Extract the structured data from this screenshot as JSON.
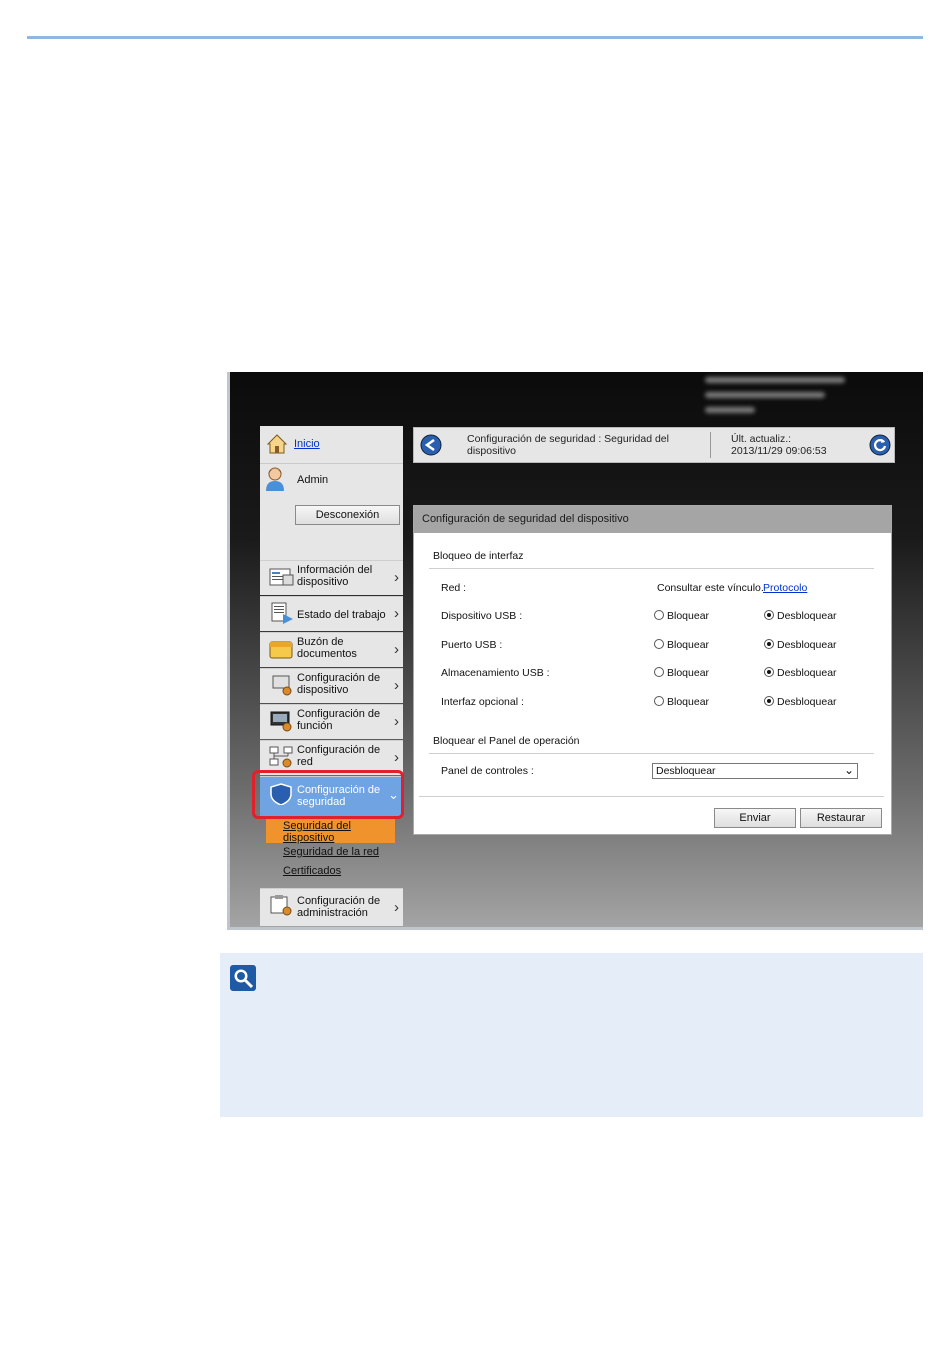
{
  "sidebar": {
    "home_label": "Inicio",
    "user_label": "Admin",
    "logout_label": "Desconexión",
    "nav": [
      "Información del dispositivo",
      "Estado del trabajo",
      "Buzón de documentos",
      "Configuración de dispositivo",
      "Configuración de función",
      "Configuración de red",
      "Configuración de seguridad",
      "Configuración de administración"
    ],
    "sub": [
      "Seguridad del dispositivo",
      "Seguridad de la red",
      "Certificados"
    ]
  },
  "header": {
    "title": "Configuración de seguridad : Seguridad del dispositivo",
    "last_update_label": "Últ. actualiz.:",
    "last_update_value": "2013/11/29 09:06:53"
  },
  "panel": {
    "title": "Configuración de seguridad del dispositivo",
    "section_interface": "Bloqueo de interfaz",
    "network_label": "Red :",
    "network_hint": "Consultar este vínculo.",
    "network_link": "Protocolo",
    "rows": [
      {
        "label": "Dispositivo USB :",
        "lock": "Bloquear",
        "unlock": "Desbloquear",
        "selected": "unlock"
      },
      {
        "label": "Puerto USB :",
        "lock": "Bloquear",
        "unlock": "Desbloquear",
        "selected": "unlock"
      },
      {
        "label": "Almacenamiento USB :",
        "lock": "Bloquear",
        "unlock": "Desbloquear",
        "selected": "unlock"
      },
      {
        "label": "Interfaz opcional :",
        "lock": "Bloquear",
        "unlock": "Desbloquear",
        "selected": "unlock"
      }
    ],
    "section_panel": "Bloquear el Panel de operación",
    "panel_label": "Panel de controles :",
    "panel_value": "Desbloquear",
    "submit_label": "Enviar",
    "reset_label": "Restaurar"
  },
  "colors": {
    "accent": "#6fa3e2",
    "highlight": "#e0202a",
    "orange": "#f0932c"
  }
}
